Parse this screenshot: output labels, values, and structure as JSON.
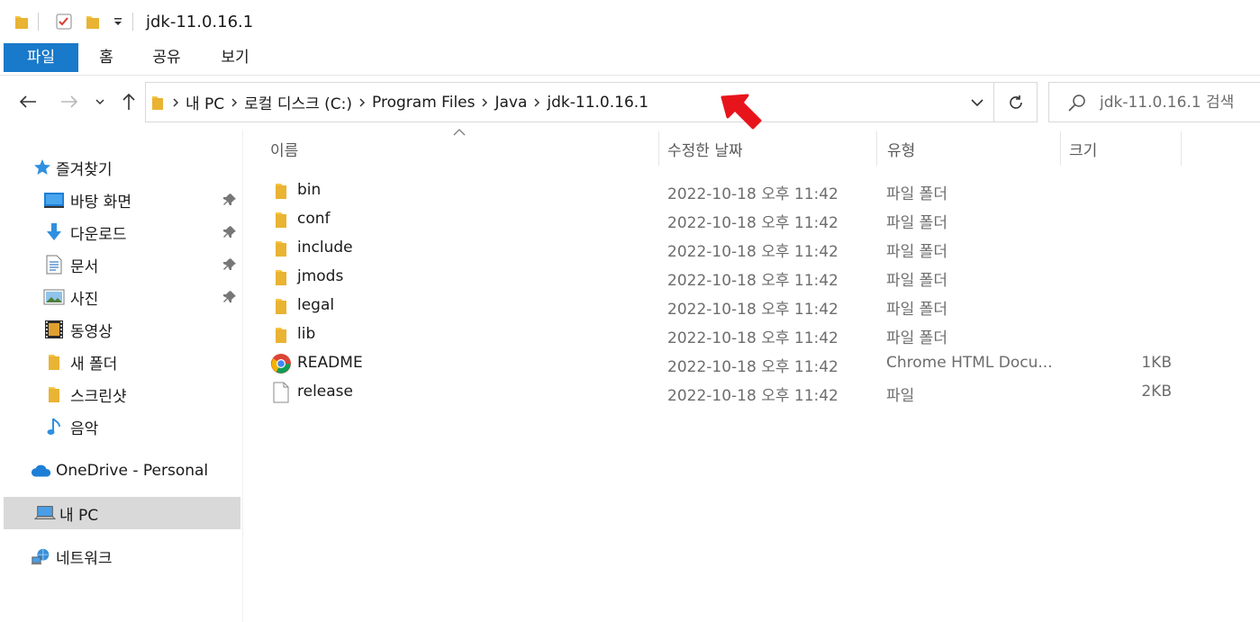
{
  "window": {
    "title": "jdk-11.0.16.1"
  },
  "ribbon": {
    "tabs": [
      {
        "label": "파일",
        "active": true
      },
      {
        "label": "홈"
      },
      {
        "label": "공유"
      },
      {
        "label": "보기"
      }
    ],
    "active_color": "#1979ca"
  },
  "address_bar": {
    "breadcrumbs": [
      "내 PC",
      "로컬 디스크 (C:)",
      "Program Files",
      "Java",
      "jdk-11.0.16.1"
    ]
  },
  "search": {
    "placeholder": "jdk-11.0.16.1 검색"
  },
  "sidebar": {
    "quick_access": {
      "label": "즐겨찾기"
    },
    "items": [
      {
        "label": "바탕 화면",
        "icon": "desktop-icon",
        "pinned": true
      },
      {
        "label": "다운로드",
        "icon": "download-icon",
        "pinned": true
      },
      {
        "label": "문서",
        "icon": "documents-icon",
        "pinned": true
      },
      {
        "label": "사진",
        "icon": "pictures-icon",
        "pinned": true
      },
      {
        "label": "동영상",
        "icon": "videos-icon"
      },
      {
        "label": "새 폴더",
        "icon": "folder-icon"
      },
      {
        "label": "스크린샷",
        "icon": "folder-icon"
      },
      {
        "label": "음악",
        "icon": "music-icon"
      }
    ],
    "onedrive": {
      "label": "OneDrive - Personal"
    },
    "this_pc": {
      "label": "내 PC",
      "selected": true
    },
    "network": {
      "label": "네트워크"
    }
  },
  "columns": {
    "name": "이름",
    "date": "수정한 날짜",
    "type": "유형",
    "size": "크기"
  },
  "files": [
    {
      "name": "bin",
      "date": "2022-10-18 오후 11:42",
      "type": "파일 폴더",
      "size": "",
      "icon": "folder-icon"
    },
    {
      "name": "conf",
      "date": "2022-10-18 오후 11:42",
      "type": "파일 폴더",
      "size": "",
      "icon": "folder-icon"
    },
    {
      "name": "include",
      "date": "2022-10-18 오후 11:42",
      "type": "파일 폴더",
      "size": "",
      "icon": "folder-icon"
    },
    {
      "name": "jmods",
      "date": "2022-10-18 오후 11:42",
      "type": "파일 폴더",
      "size": "",
      "icon": "folder-icon"
    },
    {
      "name": "legal",
      "date": "2022-10-18 오후 11:42",
      "type": "파일 폴더",
      "size": "",
      "icon": "folder-icon"
    },
    {
      "name": "lib",
      "date": "2022-10-18 오후 11:42",
      "type": "파일 폴더",
      "size": "",
      "icon": "folder-icon"
    },
    {
      "name": "README",
      "date": "2022-10-18 오후 11:42",
      "type": "Chrome HTML Docu...",
      "size": "1KB",
      "icon": "chrome-icon"
    },
    {
      "name": "release",
      "date": "2022-10-18 오후 11:42",
      "type": "파일",
      "size": "2KB",
      "icon": "file-icon"
    }
  ],
  "colors": {
    "folder_yellow": "#f8c646",
    "selection_gray": "#d9d9d9",
    "annotation_red": "#e8141c"
  }
}
